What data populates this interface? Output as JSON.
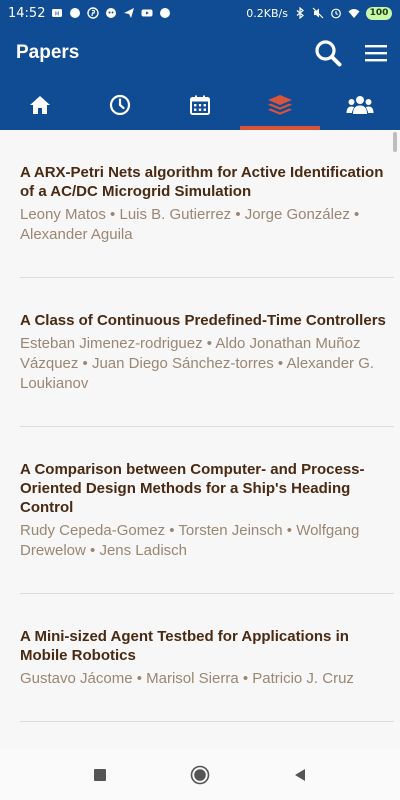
{
  "status_bar": {
    "time": "14:52",
    "network_speed": "0.2KB/s",
    "battery": "100",
    "notification_icons": [
      "whatsapp-icon",
      "circle-icon",
      "pinterest-icon",
      "dragon-icon",
      "send-icon",
      "youtube-icon",
      "circle-icon"
    ],
    "system_icons": [
      "bluetooth-icon",
      "no-sound-icon",
      "alarm-icon",
      "wifi-icon",
      "battery-icon"
    ]
  },
  "app_bar": {
    "title": "Papers",
    "actions": [
      "search-icon",
      "menu-icon"
    ]
  },
  "tabs": [
    {
      "icon": "home-icon",
      "active": false
    },
    {
      "icon": "clock-icon",
      "active": false
    },
    {
      "icon": "calendar-icon",
      "active": false
    },
    {
      "icon": "layers-icon",
      "active": true
    },
    {
      "icon": "people-icon",
      "active": false
    }
  ],
  "papers": [
    {
      "title": "A ARX-Petri Nets algorithm for Active Identification of a AC/DC Microgrid Simulation",
      "authors": "Leony Matos • Luis B. Gutierrez • Jorge González • Alexander Aguila"
    },
    {
      "title": "A Class of Continuous Predefined-Time Controllers",
      "authors": "Esteban Jimenez-rodriguez • Aldo Jonathan Muñoz Vázquez • Juan Diego Sánchez-torres • Alexander G. Loukianov"
    },
    {
      "title": "A Comparison between Computer- and Process-Oriented Design Methods for a Ship's Heading Control",
      "authors": "Rudy Cepeda-Gomez • Torsten Jeinsch • Wolfgang Drewelow • Jens Ladisch"
    },
    {
      "title": "A Mini-sized Agent Testbed for Applications in Mobile Robotics",
      "authors": "Gustavo Jácome • Marisol Sierra • Patricio J. Cruz"
    }
  ],
  "colors": {
    "primary": "#0f4c93",
    "tab_indicator": "#d8553a",
    "title_text": "#4a2a12",
    "author_text": "#9a8672"
  },
  "nav_bar": [
    "recents-square-icon",
    "home-circle-icon",
    "back-triangle-icon"
  ]
}
